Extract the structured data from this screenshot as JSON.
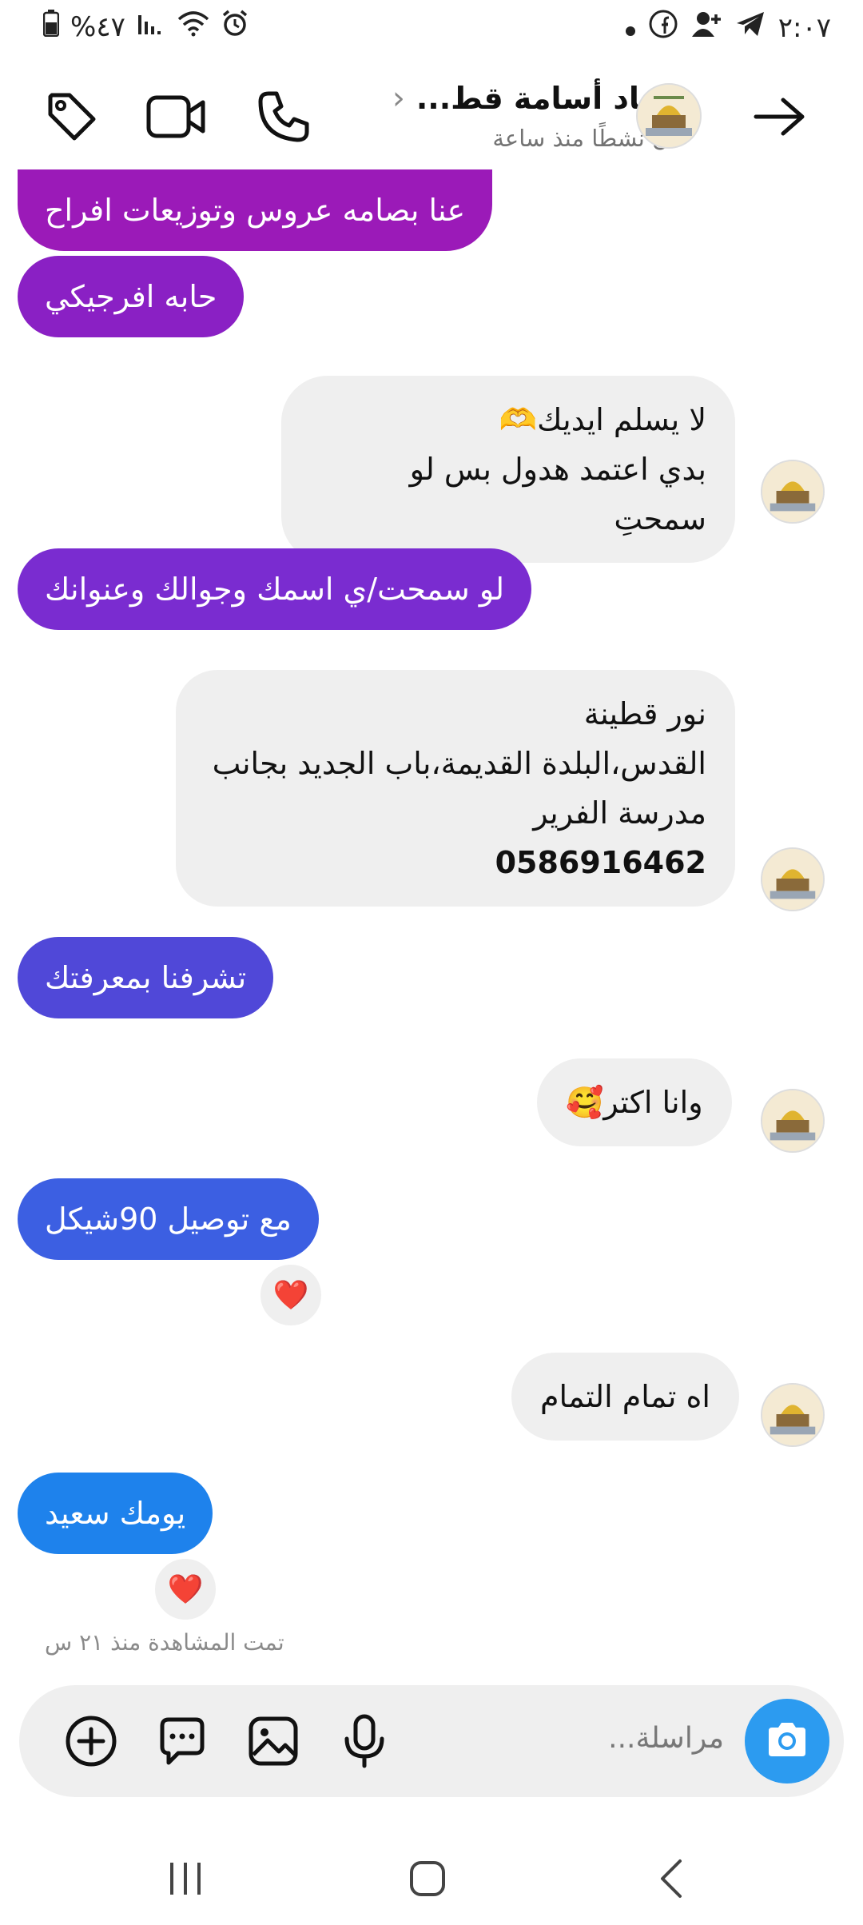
{
  "status_bar": {
    "time": "٢:٠٧",
    "battery": "%٤٧"
  },
  "header": {
    "contact_name": "سعاد أسامة قط...",
    "active_status": "كان نشطًا منذ ساعة"
  },
  "messages": [
    {
      "text": "عنا بصامه عروس وتوزيعات افراح"
    },
    {
      "text": "حابه افرجيكي"
    },
    {
      "lines": [
        "لا يسلم ايديك🫶",
        "بدي اعتمد هدول بس لو سمحتِ"
      ]
    },
    {
      "text": "لو سمحت/ي اسمك وجوالك وعنوانك"
    },
    {
      "lines": [
        "نور قطينة",
        "القدس،البلدة القديمة،باب الجديد بجانب",
        "مدرسة الفرير",
        "0586916462"
      ]
    },
    {
      "text": "تشرفنا بمعرفتك"
    },
    {
      "text": "وانا اكتر🥰"
    },
    {
      "text": "مع توصيل 90شيكل",
      "reaction": "❤️"
    },
    {
      "text": "اه تمام التمام"
    },
    {
      "text": "يومك سعيد",
      "reaction": "❤️"
    }
  ],
  "seen_text": "تمت المشاهدة منذ ٢١ س",
  "composer": {
    "placeholder": "مراسلة..."
  },
  "colors": {
    "bubble_1": "#9b1ab8",
    "bubble_2": "#8a20c4",
    "bubble_3": "#7a2cd0",
    "bubble_4": "#5048d8",
    "bubble_5": "#3c5fe2",
    "bubble_6": "#1e82ec",
    "camera": "#2c9bf0"
  },
  "icons": {
    "header": [
      "tag-icon",
      "video-call-icon",
      "phone-icon",
      "back-arrow-icon"
    ],
    "composer": [
      "add-icon",
      "sticker-icon",
      "gallery-icon",
      "mic-icon",
      "camera-icon"
    ],
    "nav": [
      "recents-icon",
      "home-icon",
      "back-icon"
    ]
  }
}
